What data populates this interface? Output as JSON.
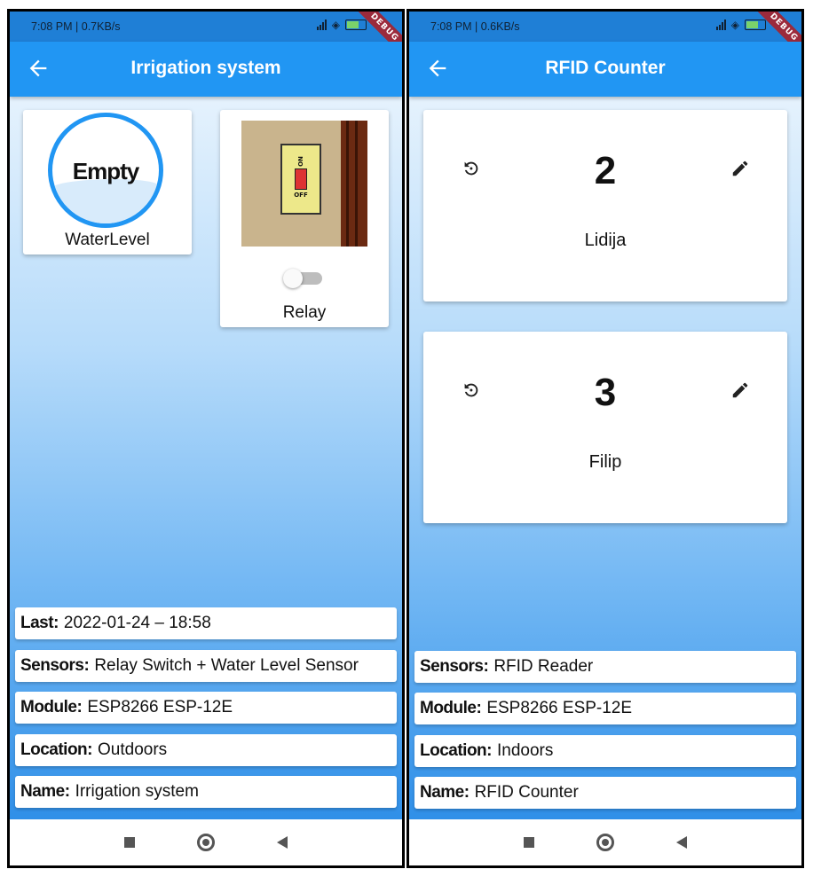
{
  "left": {
    "status": {
      "time": "7:08 PM | 0.7KB/s",
      "debug": "DEBUG"
    },
    "appbar": {
      "title": "Irrigation system"
    },
    "waterlevel": {
      "value_text": "Empty",
      "label": "WaterLevel",
      "fill_level": 0.0
    },
    "relay": {
      "label": "Relay",
      "switch_on_text": "ON",
      "switch_off_text": "OFF",
      "state_on": false
    },
    "info": [
      {
        "key": "Last:",
        "value": "2022-01-24 – 18:58"
      },
      {
        "key": "Sensors:",
        "value": "Relay Switch + Water Level Sensor"
      },
      {
        "key": "Module:",
        "value": "ESP8266 ESP-12E"
      },
      {
        "key": "Location:",
        "value": "Outdoors"
      },
      {
        "key": "Name:",
        "value": "Irrigation system"
      }
    ]
  },
  "right": {
    "status": {
      "time": "7:08 PM | 0.6KB/s",
      "debug": "DEBUG"
    },
    "appbar": {
      "title": "RFID Counter"
    },
    "counters": [
      {
        "value": "2",
        "name": "Lidija"
      },
      {
        "value": "3",
        "name": "Filip"
      }
    ],
    "info": [
      {
        "key": "Sensors:",
        "value": "RFID Reader"
      },
      {
        "key": "Module:",
        "value": "ESP8266 ESP-12E"
      },
      {
        "key": "Location:",
        "value": "Indoors"
      },
      {
        "key": "Name:",
        "value": "RFID Counter"
      }
    ]
  },
  "colors": {
    "primary": "#2196f3",
    "status_bar": "#1f7fd6",
    "debug_banner": "#9b2a3b"
  }
}
